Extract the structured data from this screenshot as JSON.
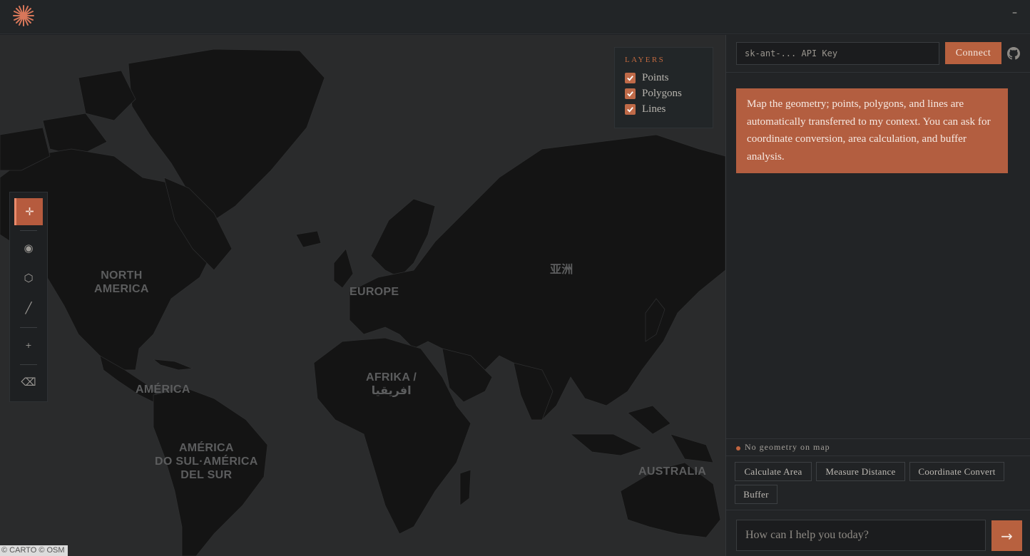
{
  "header": {
    "logo_icon": "asterisk-logo-icon",
    "minimize_label": "–"
  },
  "map": {
    "labels": {
      "north_america": "NORTH\nAMERICA",
      "europe": "EUROPE",
      "asia": "亚洲",
      "america": "AMÉRICA",
      "africa": "AFRIKA /\nافريقيا",
      "south_america": "AMÉRICA\nDO SUL·AMÉRICA\nDEL SUR",
      "australia": "AUSTRALIA"
    },
    "attribution": "© CARTO © OSM"
  },
  "layers": {
    "title": "LAYERS",
    "items": [
      {
        "label": "Points",
        "checked": true
      },
      {
        "label": "Polygons",
        "checked": true
      },
      {
        "label": "Lines",
        "checked": true
      }
    ]
  },
  "tools": {
    "select": "✛",
    "point": "◉",
    "polygon": "⬡",
    "line": "╱",
    "add": "+",
    "clear": "⌫"
  },
  "panel": {
    "api_placeholder": "sk-ant-... API Key",
    "connect_label": "Connect",
    "message": "Map the geometry; points, polygons, and lines are automatically transferred to my context. You can ask for coordinate conversion, area calculation, and buffer analysis.",
    "status": "No geometry on map",
    "quick_actions": [
      "Calculate Area",
      "Measure Distance",
      "Coordinate Convert",
      "Buffer"
    ],
    "chat_placeholder": "How can I help you today?",
    "send_label": "→"
  },
  "colors": {
    "accent": "#b8613f",
    "land": "#141414",
    "water": "#2a2b2c"
  }
}
